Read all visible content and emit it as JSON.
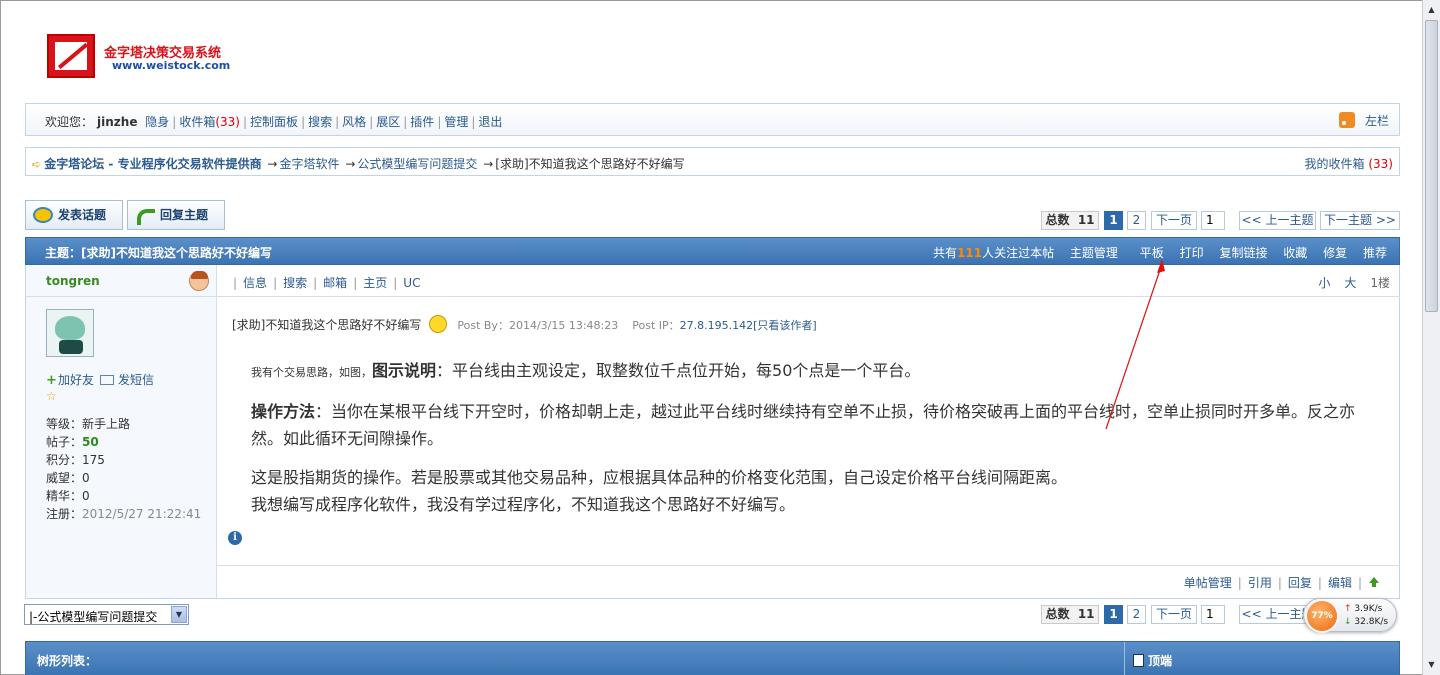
{
  "logo": {
    "title": "金字塔决策交易系统",
    "url": "www.weistock.com"
  },
  "topbar": {
    "welcome": "欢迎您：",
    "username": "jinzhe",
    "items": [
      "隐身",
      "收件箱",
      "控制面板",
      "搜索",
      "风格",
      "展区",
      "插件",
      "管理",
      "退出"
    ],
    "inbox_count": "(33)",
    "sidebar_label": "左栏"
  },
  "breadcrumb": {
    "forum": "金字塔论坛",
    "slogan": "- 专业程序化交易软件提供商",
    "arrow": "→",
    "level1": "金字塔软件",
    "level2": "公式模型编写问题提交",
    "current": "[求助]不知道我这个思路好不好编写",
    "my_inbox": "我的收件箱",
    "my_inbox_count": "(33)"
  },
  "actions": {
    "new_topic": "发表话题",
    "reply_topic": "回复主题"
  },
  "pager": {
    "total_label": "总数",
    "total": "11",
    "pages": [
      "1",
      "2"
    ],
    "current_page": "1",
    "next": "下一页",
    "page_input": "1",
    "prev_topic": "<< 上一主题",
    "next_topic": "下一主题 >>"
  },
  "thread": {
    "title": "主题：[求助]不知道我这个思路好不好编写",
    "followers_pre": "共有",
    "followers_count": "111",
    "followers_post": "人关注过本帖",
    "tools": [
      "主题管理",
      "平板",
      "打印",
      "复制链接",
      "收藏",
      "修复",
      "推荐"
    ]
  },
  "author": {
    "name": "tongren",
    "add_friend": "加好友",
    "send_msg": "发短信",
    "star": "☆",
    "stats": {
      "level_label": "等级：",
      "level": "新手上路",
      "posts_label": "帖子：",
      "posts": "50",
      "points_label": "积分：",
      "points": "175",
      "prestige_label": "威望：",
      "prestige": "0",
      "essence_label": "精华：",
      "essence": "0",
      "reg_label": "注册：",
      "reg": "2012/5/27 21:22:41"
    }
  },
  "post": {
    "links": [
      "信息",
      "搜索",
      "邮箱",
      "主页",
      "UC"
    ],
    "size_small": "小",
    "size_large": "大",
    "floor": "1楼",
    "title": "[求助]不知道我这个思路好不好编写",
    "post_by_label": "Post By：",
    "post_by": "2014/3/15 13:48:23",
    "post_ip_label": "Post IP：",
    "post_ip": "27.8.195.142",
    "author_only": "[只看该作者]",
    "p1_small": "我有个交易思路，如图，",
    "p1_bold": "图示说明",
    "p1_text": "：平台线由主观设定，取整数位千点位开始，每50个点是一个平台。",
    "p2_bold": "操作方法",
    "p2_text": "：当你在某根平台线下开空时，价格却朝上走，越过此平台线时继续持有空单不止损，待价格突破再上面的平台线时，空单止损同时开多单。反之亦然。如此循环无间隙操作。",
    "p3": "这是股指期货的操作。若是股票或其他交易品种，应根据具体品种的价格变化范围，自己设定价格平台线间隔距离。",
    "p4": "我想编写成程序化软件，我没有学过程序化，不知道我这个思路好不好编写。",
    "foot_links": [
      "单帖管理",
      "引用",
      "回复",
      "编辑"
    ],
    "info_icon": "i"
  },
  "bottom": {
    "jump_value": "|-公式模型编写问题提交",
    "tree_label": "树形列表：",
    "top_label": "顶端"
  },
  "speed": {
    "percent": "77%",
    "up": "3.9K/s",
    "down": "32.8K/s"
  },
  "colors": {
    "header_blue": "#3b74b3",
    "link": "#2b5b8f",
    "accent_red": "#d8131a",
    "orange": "#ff8a00"
  }
}
